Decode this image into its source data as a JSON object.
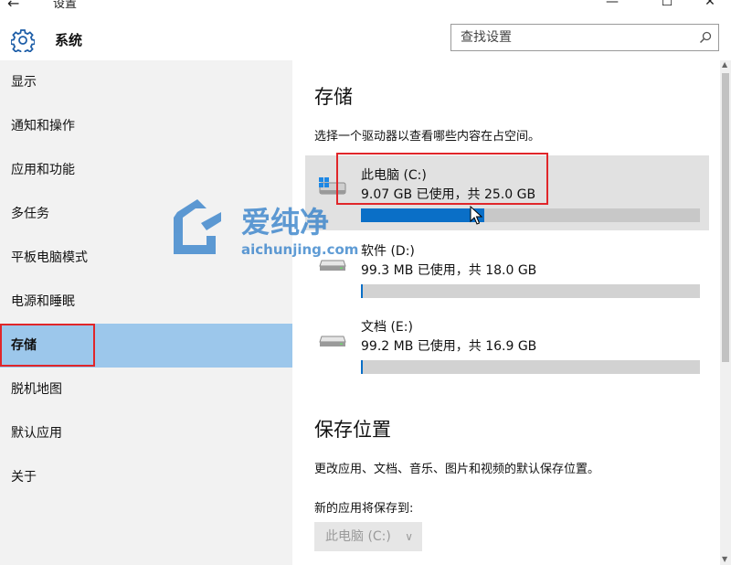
{
  "window": {
    "title": "设置",
    "back_glyph": "←",
    "minimize_glyph": "—",
    "maximize_glyph": "☐",
    "close_glyph": "✕"
  },
  "header": {
    "icon": "gear-icon",
    "title": "系统",
    "search_placeholder": "查找设置",
    "search_icon": "search-icon"
  },
  "sidebar": {
    "items": [
      {
        "label": "显示",
        "active": false
      },
      {
        "label": "通知和操作",
        "active": false
      },
      {
        "label": "应用和功能",
        "active": false
      },
      {
        "label": "多任务",
        "active": false
      },
      {
        "label": "平板电脑模式",
        "active": false
      },
      {
        "label": "电源和睡眠",
        "active": false
      },
      {
        "label": "存储",
        "active": true
      },
      {
        "label": "脱机地图",
        "active": false
      },
      {
        "label": "默认应用",
        "active": false
      },
      {
        "label": "关于",
        "active": false
      }
    ]
  },
  "storage": {
    "title": "存储",
    "description": "选择一个驱动器以查看哪些内容在占空间。",
    "drives": [
      {
        "name": "此电脑 (C:)",
        "usage": "9.07 GB 已使用，共 25.0 GB",
        "used_fraction": 0.363,
        "icon": "windows-drive-icon",
        "selected": true
      },
      {
        "name": "软件 (D:)",
        "usage": "99.3 MB 已使用，共 18.0 GB",
        "used_fraction": 0.0054,
        "icon": "drive-icon",
        "selected": false
      },
      {
        "name": "文档 (E:)",
        "usage": "99.2 MB 已使用，共 16.9 GB",
        "used_fraction": 0.0057,
        "icon": "drive-icon",
        "selected": false
      }
    ]
  },
  "save_locations": {
    "title": "保存位置",
    "description": "更改应用、文档、音乐、图片和视频的默认保存位置。",
    "new_apps_label": "新的应用将保存到:",
    "new_apps_value": "此电脑 (C:)"
  },
  "watermark": {
    "text": "爱纯净",
    "url": "aichunjing.com"
  },
  "colors": {
    "accent": "#0a6fc7",
    "sidebar_active": "#9cc7eb",
    "highlight_box": "#e0262a"
  }
}
